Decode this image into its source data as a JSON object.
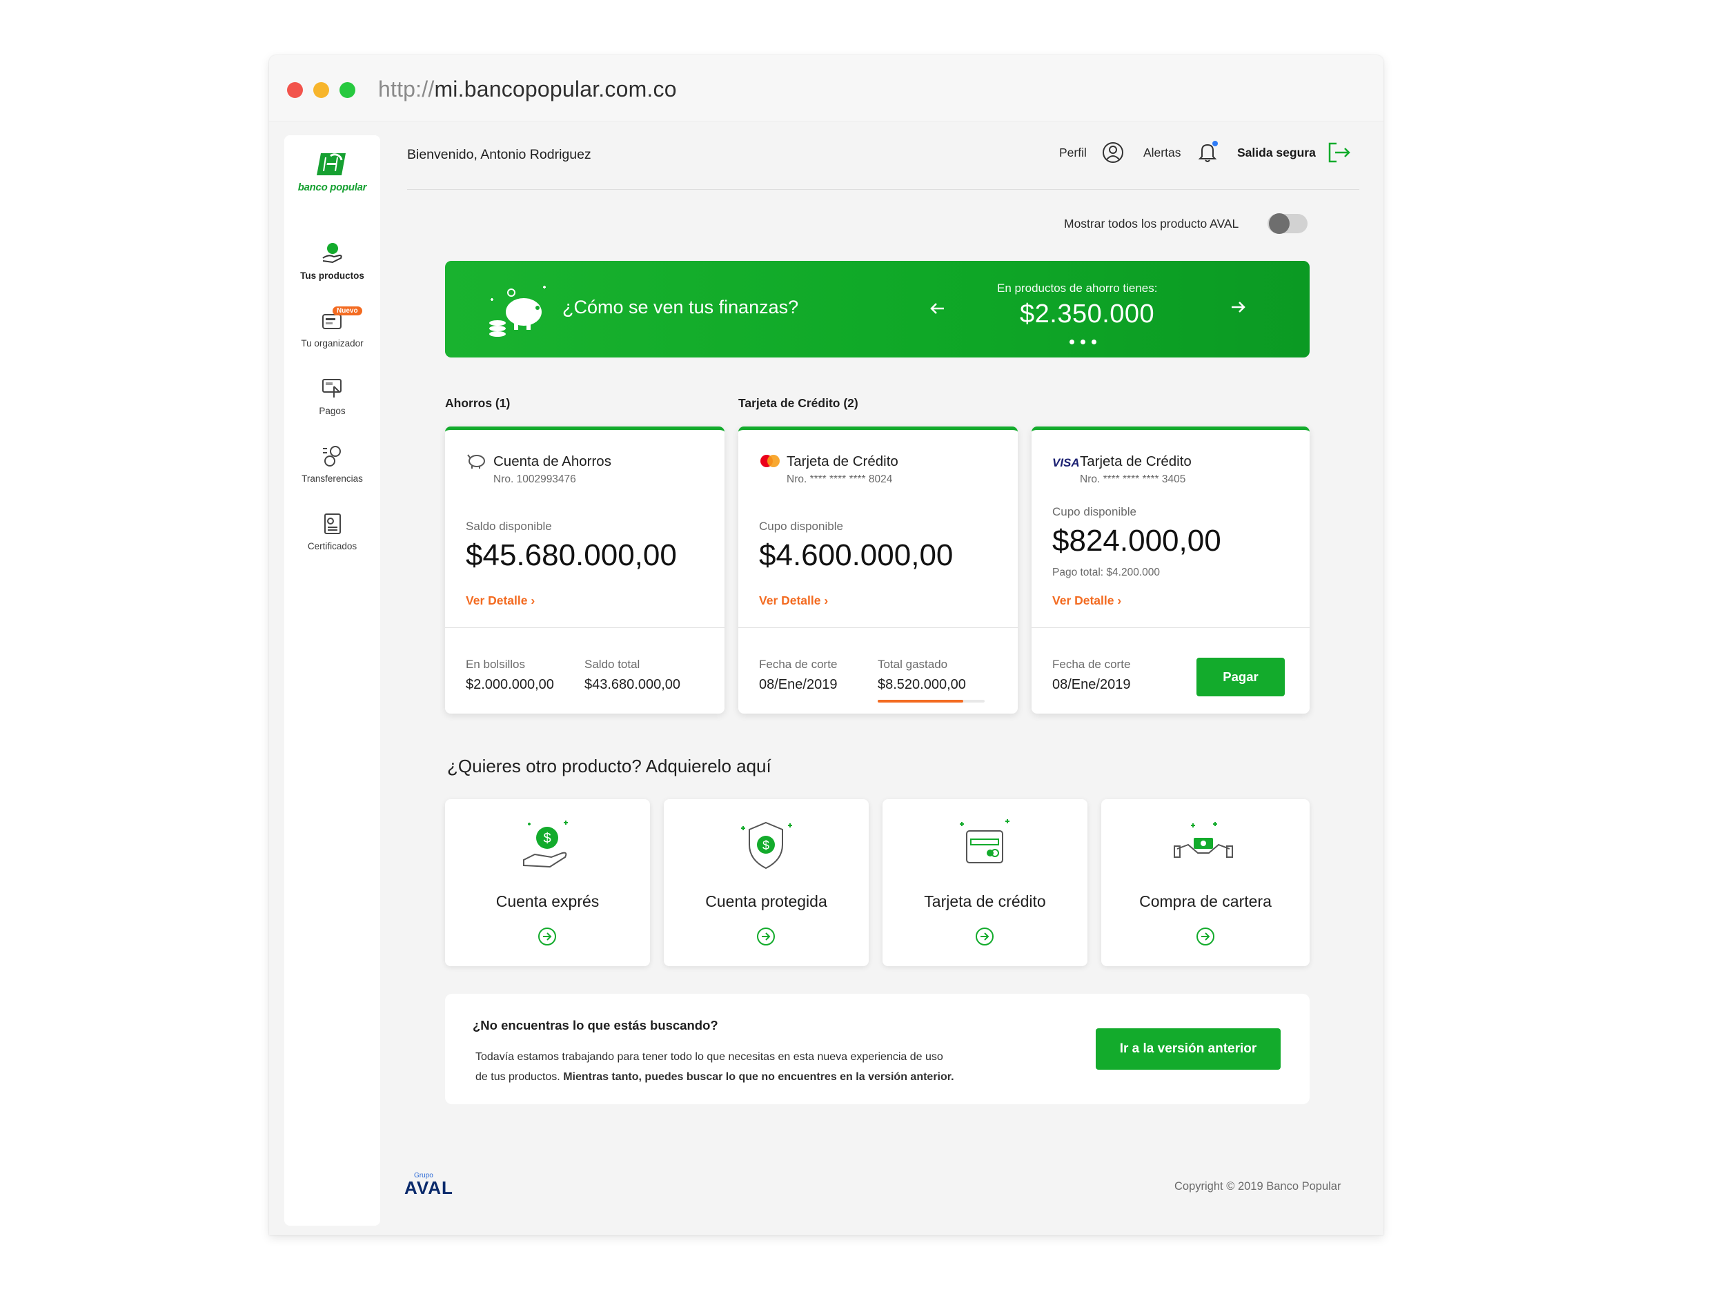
{
  "browser": {
    "url_protocol": "http://",
    "url_host": "mi.bancopopular.com.co"
  },
  "brand": {
    "logo_text": "banco popular",
    "green": "#13ab2c",
    "orange": "#f36b21"
  },
  "sidebar": {
    "items": [
      {
        "label": "Tus productos",
        "icon": "hand-coin-icon",
        "active": true
      },
      {
        "label": "Tu organizador",
        "icon": "wallet-icon",
        "badge": "Nuevo"
      },
      {
        "label": "Pagos",
        "icon": "payment-screen-icon"
      },
      {
        "label": "Transferencias",
        "icon": "transfer-icon"
      },
      {
        "label": "Certificados",
        "icon": "certificate-icon"
      }
    ]
  },
  "header": {
    "welcome": "Bienvenido, Antonio Rodriguez",
    "profile": "Perfil",
    "alerts": "Alertas",
    "logout": "Salida segura"
  },
  "toggle": {
    "label": "Mostrar todos los producto AVAL",
    "on": false
  },
  "banner": {
    "question": "¿Cómo se ven tus finanzas?",
    "subtitle": "En productos de ahorro tienes:",
    "amount": "$2.350.000"
  },
  "sections": {
    "savings": "Ahorros (1)",
    "credit": "Tarjeta de Crédito (2)"
  },
  "cards": [
    {
      "title": "Cuenta de Ahorros",
      "number": "Nro. 1002993476",
      "balance_label": "Saldo disponible",
      "balance": "$45.680.000,00",
      "detail": "Ver Detalle",
      "footer": [
        {
          "label": "En bolsillos",
          "value": "$2.000.000,00"
        },
        {
          "label": "Saldo total",
          "value": "$43.680.000,00"
        }
      ]
    },
    {
      "title": "Tarjeta de Crédito",
      "number": "Nro. **** **** **** 8024",
      "balance_label": "Cupo disponible",
      "balance": "$4.600.000,00",
      "detail": "Ver Detalle",
      "footer": [
        {
          "label": "Fecha de corte",
          "value": "08/Ene/2019"
        },
        {
          "label": "Total gastado",
          "value": "$8.520.000,00"
        }
      ]
    },
    {
      "title": "Tarjeta de Crédito",
      "brand_mark": "VISA",
      "number": "Nro. **** **** **** 3405",
      "balance_label": "Cupo disponible",
      "balance": "$824.000,00",
      "payment": "Pago total: $4.200.000",
      "detail": "Ver Detalle",
      "footer": [
        {
          "label": "Fecha de corte",
          "value": "08/Ene/2019"
        }
      ],
      "pay_button": "Pagar"
    }
  ],
  "offer": {
    "title": "¿Quieres otro producto? Adquierelo aquí",
    "products": [
      "Cuenta exprés",
      "Cuenta protegida",
      "Tarjeta de crédito",
      "Compra de cartera"
    ]
  },
  "info": {
    "title": "¿No encuentras lo que estás buscando?",
    "line1": "Todavía estamos trabajando para tener todo lo que necesitas en esta nueva experiencia de uso",
    "line2_a": "de tus productos. ",
    "line2_b": "Mientras tanto, puedes buscar lo que no encuentres en la versión anterior.",
    "button": "Ir a la versión anterior"
  },
  "footer": {
    "group": "Grupo",
    "aval": "AVAL",
    "copyright": "Copyright © 2019 Banco Popular"
  }
}
